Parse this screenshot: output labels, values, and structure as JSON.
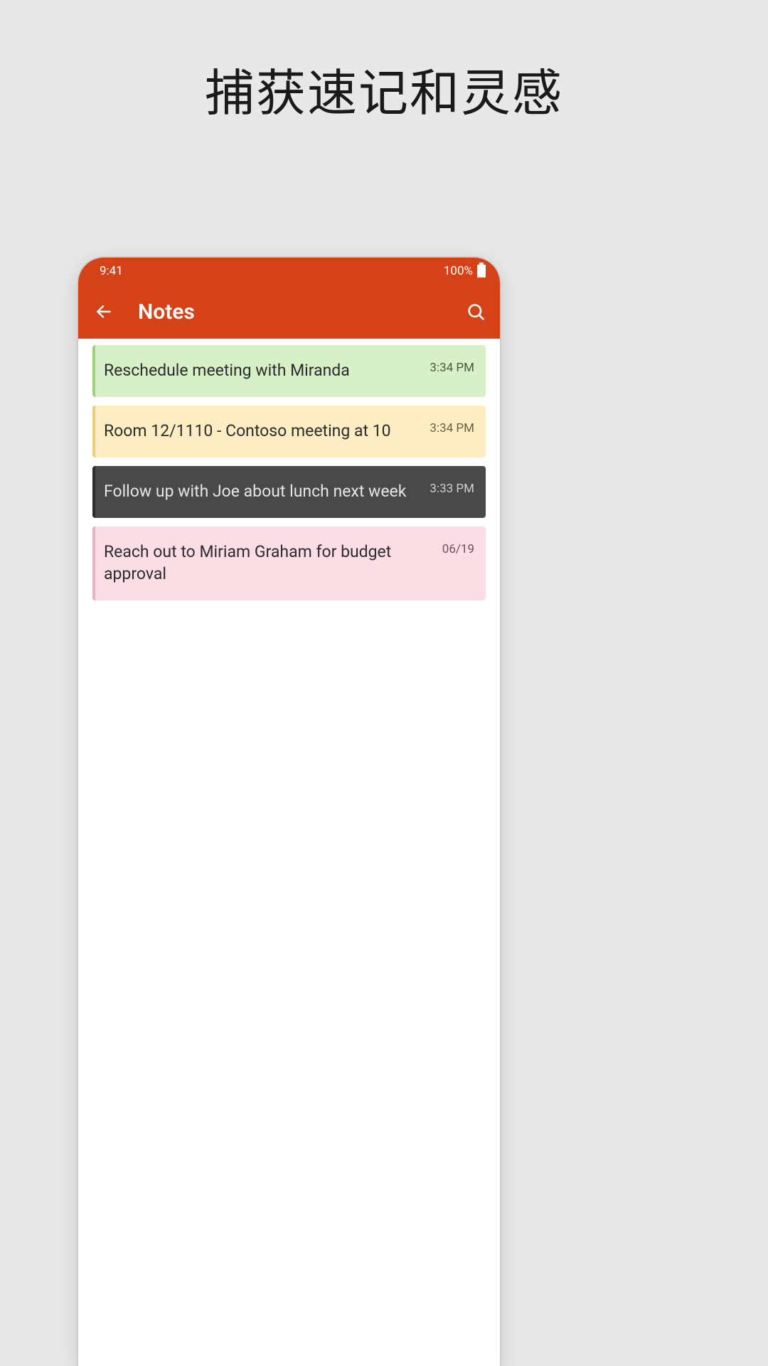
{
  "headline": "捕获速记和灵感",
  "status": {
    "time": "9:41",
    "battery_label": "100%"
  },
  "appbar": {
    "title": "Notes"
  },
  "notes": [
    {
      "text": "Reschedule meeting with Miranda",
      "time": "3:34 PM",
      "theme": "green"
    },
    {
      "text": "Room 12/1110 - Contoso meeting at 10",
      "time": "3:34 PM",
      "theme": "yellow"
    },
    {
      "text": "Follow up with Joe about lunch next week",
      "time": "3:33 PM",
      "theme": "dark"
    },
    {
      "text": "Reach out to Miriam Graham for budget approval",
      "time": "06/19",
      "theme": "pink"
    }
  ]
}
